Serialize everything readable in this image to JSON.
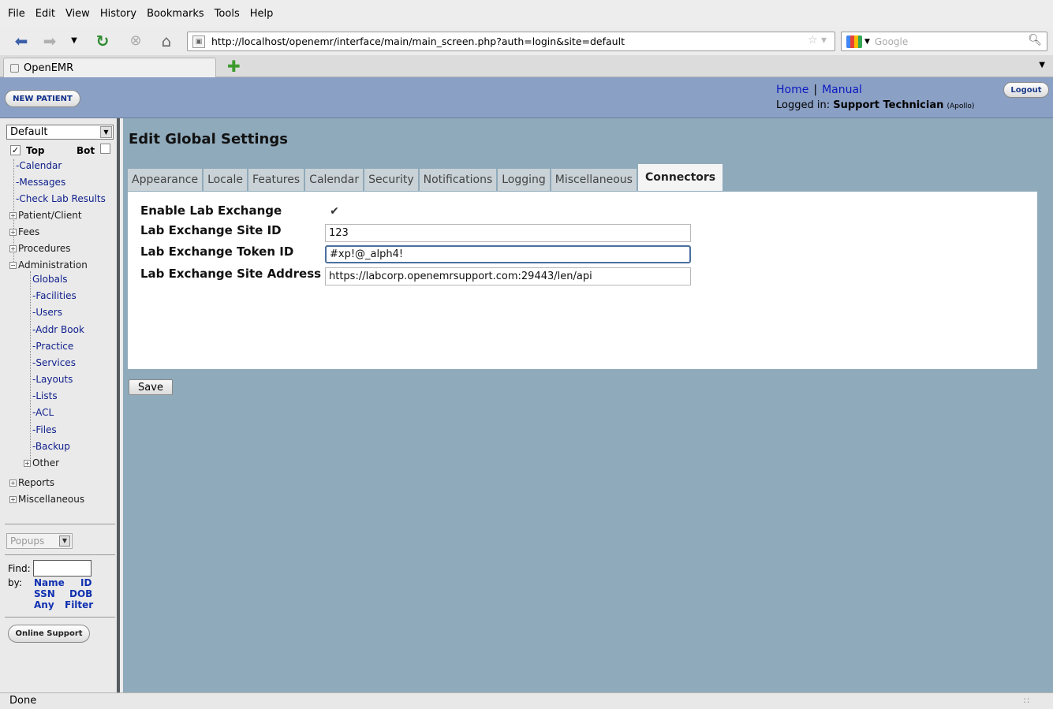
{
  "browser": {
    "menu": [
      "File",
      "Edit",
      "View",
      "History",
      "Bookmarks",
      "Tools",
      "Help"
    ],
    "url": "http://localhost/openemr/interface/main/main_screen.php?auth=login&site=default",
    "search_placeholder": "Google",
    "tab_title": "OpenEMR",
    "status": "Done"
  },
  "header": {
    "new_patient": "NEW PATIENT",
    "home": "Home",
    "sep": "|",
    "manual": "Manual",
    "logged_in_label": "Logged in:",
    "user": "Support Technician",
    "site": "(Apollo)",
    "logout": "Logout"
  },
  "nav": {
    "facility": "Default",
    "top_label": "Top",
    "bot_label": "Bot",
    "items": [
      "Calendar",
      "Messages",
      "Check Lab Results",
      "Patient/Client",
      "Fees",
      "Procedures",
      "Administration"
    ],
    "admin_items": [
      "Globals",
      "Facilities",
      "Users",
      "Addr Book",
      "Practice",
      "Services",
      "Layouts",
      "Lists",
      "ACL",
      "Files",
      "Backup",
      "Other"
    ],
    "bottom_items": [
      "Reports",
      "Miscellaneous"
    ],
    "popups": "Popups",
    "find_label": "Find:",
    "by_label": "by:",
    "find_options": [
      "Name",
      "ID",
      "SSN",
      "DOB",
      "Any",
      "Filter"
    ],
    "online_support": "Online Support"
  },
  "page": {
    "title": "Edit Global Settings",
    "tabs": [
      "Appearance",
      "Locale",
      "Features",
      "Calendar",
      "Security",
      "Notifications",
      "Logging",
      "Miscellaneous",
      "Connectors"
    ],
    "active_tab": "Connectors",
    "fields": {
      "enable_lab_label": "Enable Lab Exchange",
      "enable_lab_checked": true,
      "site_id_label": "Lab Exchange Site ID",
      "site_id_value": "123",
      "token_label": "Lab Exchange Token ID",
      "token_value": "#xp!@_alph4!",
      "address_label": "Lab Exchange Site Address",
      "address_value": "https://labcorp.openemrsupport.com:29443/len/api"
    },
    "save": "Save"
  }
}
